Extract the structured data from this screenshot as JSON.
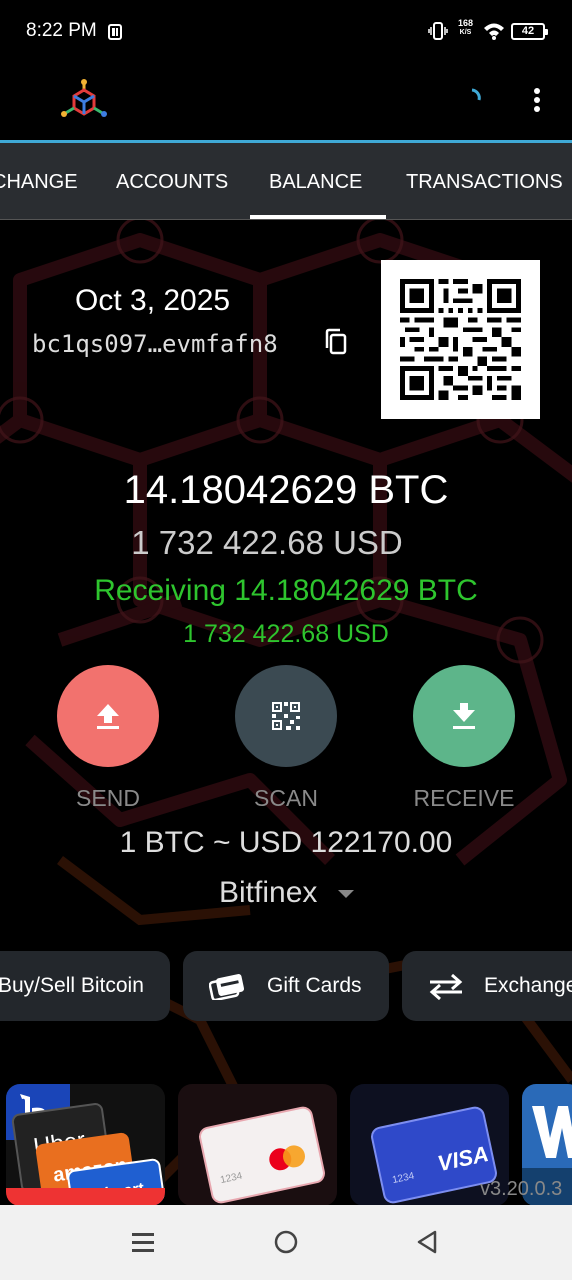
{
  "status_bar": {
    "time": "8:22 PM",
    "speed_value": "168",
    "speed_unit": "K/S",
    "battery": "42"
  },
  "tabs": [
    {
      "label": "CHANGE"
    },
    {
      "label": "ACCOUNTS"
    },
    {
      "label": "BALANCE"
    },
    {
      "label": "TRANSACTIONS"
    }
  ],
  "wallet": {
    "date": "Oct 3, 2025",
    "address": "bc1qs097…evmfafn8",
    "btc_balance": "14.18042629 BTC",
    "usd_balance": "1 732 422.68 USD",
    "receiving_btc": "Receiving 14.18042629 BTC",
    "receiving_usd": "1 732 422.68 USD"
  },
  "actions": {
    "send": "SEND",
    "scan": "SCAN",
    "receive": "RECEIVE"
  },
  "rate": {
    "text": "1 BTC ~ USD 122170.00",
    "exchange": "Bitfinex"
  },
  "chips": {
    "buy_sell": "Buy/Sell Bitcoin",
    "gift_cards": "Gift Cards",
    "exchange": "Exchange"
  },
  "promo": {
    "card_number": "1234",
    "visa": "VISA",
    "brands": [
      "Uber",
      "amazon",
      "Walmart"
    ]
  },
  "version": "v3.20.0.3",
  "colors": {
    "accent": "#3fa9d6",
    "send": "#f2726e",
    "scan": "#3b4a52",
    "receive": "#5db58a",
    "green_text": "#2ec52e"
  }
}
